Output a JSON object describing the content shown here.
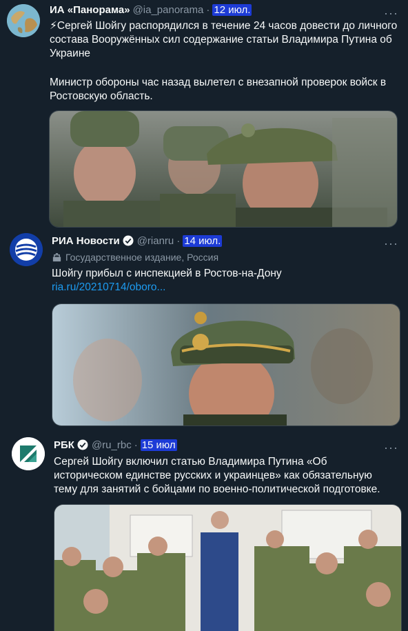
{
  "tweets": [
    {
      "name": "ИА «Панорама»",
      "handle": "@ia_panorama",
      "date": "12 июл.",
      "text1": "⚡Сергей Шойгу распорядился в течение 24 часов довести до личного состава Вооружённых сил содержание статьи Владимира Путина об Украине",
      "text2": "Министр обороны час назад вылетел с внезапной проверок войск в Ростовскую область."
    },
    {
      "name": "РИА Новости",
      "handle": "@rianru",
      "date": "14 июл.",
      "label": "Государственное издание, Россия",
      "text": "Шойгу прибыл с инспекцией в Ростов-на-Дону",
      "link": "ria.ru/20210714/oboro..."
    },
    {
      "name": "РБК",
      "handle": "@ru_rbc",
      "date": "15 июл",
      "text": "Сергей Шойгу включил статью Владимира Путина «Об историческом единстве русских и украинцев» как обязательную тему для занятий с бойцами по военно-политической подготовке."
    }
  ],
  "ui": {
    "more": "···",
    "dot": "·"
  },
  "colors": {
    "background": "#15202b",
    "accent": "#1d9bf0",
    "highlight": "#1d3bd6",
    "muted": "#8b98a5"
  }
}
